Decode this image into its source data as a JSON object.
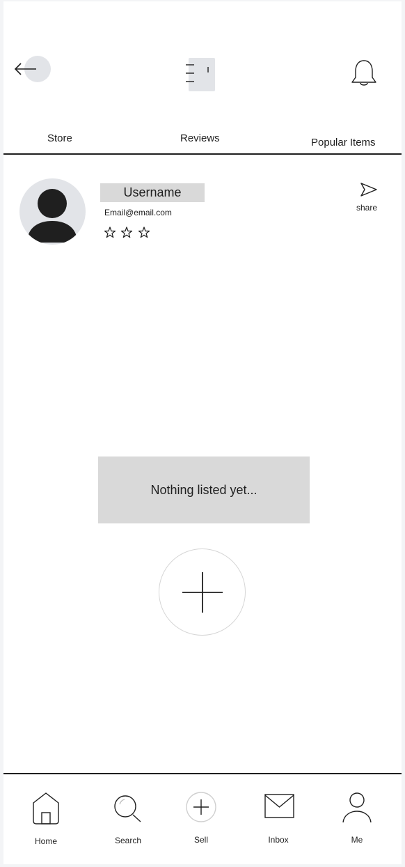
{
  "header": {
    "back_icon": "arrow-left-icon",
    "menu_icon": "menu-icon",
    "notification_icon": "bell-icon"
  },
  "tabs": [
    {
      "label": "Store"
    },
    {
      "label": "Reviews"
    },
    {
      "label": "Popular Items"
    }
  ],
  "profile": {
    "username": "Username",
    "email": "Email@email.com",
    "rating_stars": 3,
    "share_label": "share",
    "share_icon": "send-icon"
  },
  "listings": {
    "empty_text": "Nothing listed yet...",
    "add_icon": "plus-icon"
  },
  "bottom_nav": [
    {
      "label": "Home",
      "icon": "home-icon"
    },
    {
      "label": "Search",
      "icon": "search-icon"
    },
    {
      "label": "Sell",
      "icon": "plus-circle-icon"
    },
    {
      "label": "Inbox",
      "icon": "mail-icon"
    },
    {
      "label": "Me",
      "icon": "user-icon"
    }
  ],
  "colors": {
    "background": "#ffffff",
    "placeholder_gray": "#d9d9d9",
    "light_gray": "#e2e4e8",
    "ink": "#1f1f1f"
  }
}
